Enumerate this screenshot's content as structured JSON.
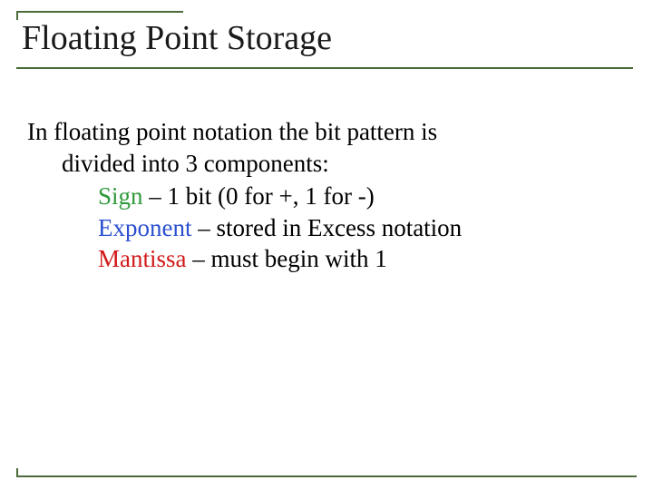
{
  "title": "Floating Point Storage",
  "intro_line1": "In floating point notation the bit pattern is",
  "intro_line2": "divided into 3 components:",
  "components": {
    "sign": {
      "label": "Sign",
      "desc": " – 1 bit (0 for +, 1 for -)"
    },
    "exp": {
      "label": "Exponent",
      "desc": " – stored in Excess notation"
    },
    "mant": {
      "label": "Mantissa",
      "desc": " – must begin with 1"
    }
  }
}
